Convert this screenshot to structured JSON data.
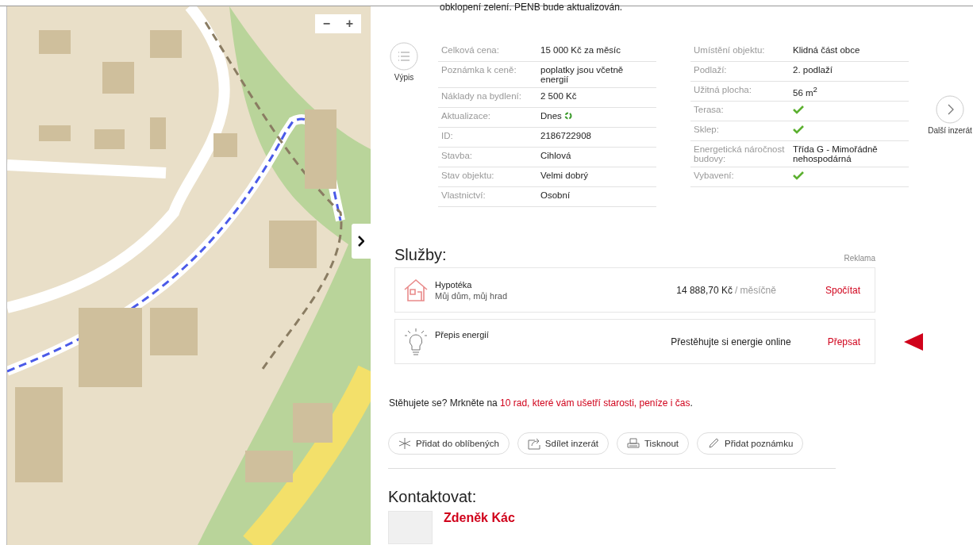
{
  "map": {
    "zoom_out": "−",
    "zoom_in": "+"
  },
  "description_tail": "obklopení zelení. PENB bude aktualizován.",
  "list_button": {
    "label": "Výpis"
  },
  "next_button": {
    "label": "Další inzerát"
  },
  "params_left": [
    {
      "label": "Celková cena:",
      "value": "15 000 Kč za měsíc"
    },
    {
      "label": "Poznámka k ceně:",
      "value": "poplatky jsou včetně energií"
    },
    {
      "label": "Náklady na bydlení:",
      "value": "2 500 Kč"
    },
    {
      "label": "Aktualizace:",
      "value": "Dnes",
      "fresh": true
    },
    {
      "label": "ID:",
      "value": "2186722908"
    },
    {
      "label": "Stavba:",
      "value": "Cihlová"
    },
    {
      "label": "Stav objektu:",
      "value": "Velmi dobrý"
    },
    {
      "label": "Vlastnictví:",
      "value": "Osobní"
    }
  ],
  "params_right": [
    {
      "label": "Umístění objektu:",
      "value": "Klidná část obce"
    },
    {
      "label": "Podlaží:",
      "value": "2. podlaží"
    },
    {
      "label": "Užitná plocha:",
      "value": "56 m$^{2}$"
    },
    {
      "label": "Terasa:",
      "checked": true
    },
    {
      "label": "Sklep:",
      "checked": true
    },
    {
      "label": "Energetická náročnost budovy:",
      "value": "Třída G - Mimořádně nehospodárná"
    },
    {
      "label": "Vybavení:",
      "checked": true
    }
  ],
  "services": {
    "title": "Služby:",
    "ad_label": "Reklama",
    "items": [
      {
        "kind": "mortgage",
        "name": "Hypotéka",
        "subtitle": "Můj dům, můj hrad",
        "amount": "14 888,70 Kč",
        "period": "/ měsíčně",
        "action": "Spočítat",
        "pointer": false
      },
      {
        "kind": "energy",
        "name": "Přepis energií",
        "info": "Přestěhujte si energie online",
        "action": "Přepsat",
        "pointer": true
      }
    ]
  },
  "moving_tip": {
    "text": "Stěhujete se? Mrkněte na ",
    "link": "10 rad, které vám ušetří starosti, peníze i čas",
    "end": "."
  },
  "actions": [
    {
      "kind": "star",
      "label": "Přidat do oblíbených"
    },
    {
      "kind": "share",
      "label": "Sdílet inzerát"
    },
    {
      "kind": "print",
      "label": "Tisknout"
    },
    {
      "kind": "note",
      "label": "Přidat poznámku"
    }
  ],
  "contact": {
    "title": "Kontaktovat:",
    "name": "Zdeněk Kác"
  }
}
